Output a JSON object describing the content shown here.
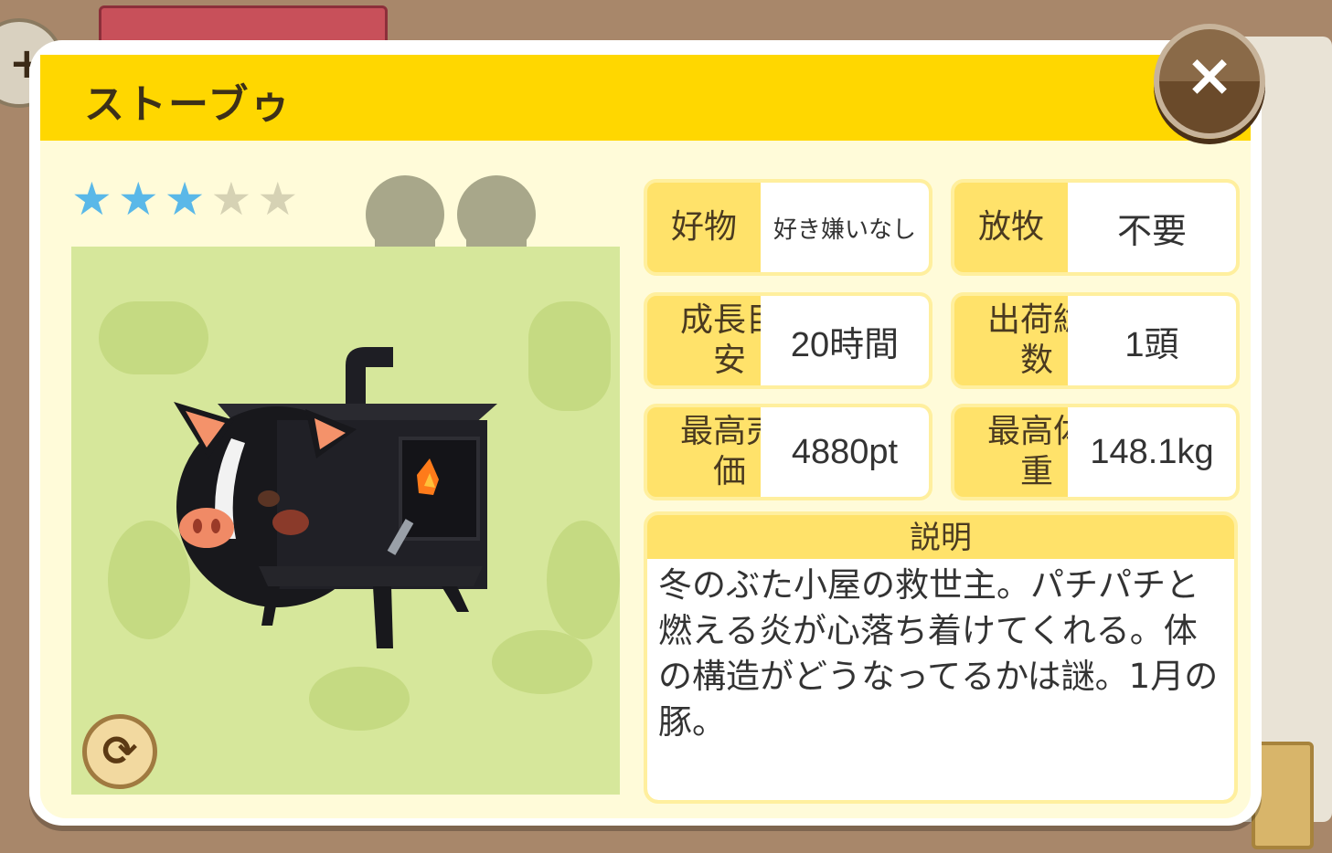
{
  "title": "ストーブゥ",
  "close_icon": "×",
  "rating": {
    "filled": 3,
    "total": 5,
    "filled_color": "#5ab8e8",
    "empty_color": "#d6d2b4"
  },
  "medals": [
    "medal-icon",
    "medal-icon"
  ],
  "stats": [
    {
      "id": "favorite",
      "label": "好物",
      "value": "好き嫌いなし"
    },
    {
      "id": "grazing",
      "label": "放牧",
      "value": "不要"
    },
    {
      "id": "growth",
      "label": "成長目安",
      "value": "20時間"
    },
    {
      "id": "shipped",
      "label": "出荷総数",
      "value": "1頭"
    },
    {
      "id": "price",
      "label": "最高売価",
      "value": "4880pt"
    },
    {
      "id": "weight",
      "label": "最高体重",
      "value": "148.1kg"
    }
  ],
  "description": {
    "header": "説明",
    "text": "冬のぶた小屋の救世主。パチパチと燃える炎が心落ち着けてくれる。体の構造がどうなってるかは謎。1月の豚。"
  },
  "swap_icon": "⟳",
  "colors": {
    "title_bar": "#ffd700",
    "panel_bg": "#fffbd9",
    "image_bg": "#d6e79b",
    "close_button": "#7a5a38"
  }
}
